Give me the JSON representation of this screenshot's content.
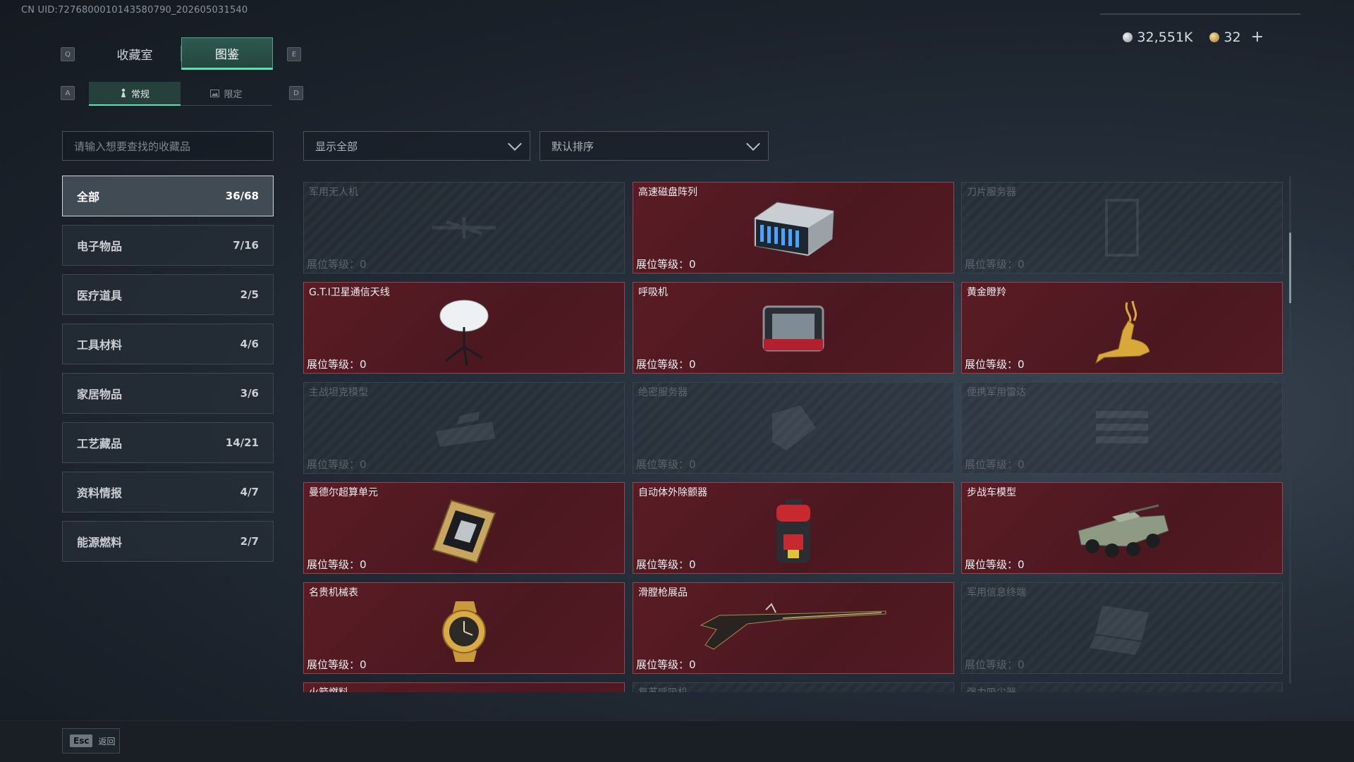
{
  "uid": "CN UID:7276800010143580790_202605031540",
  "keys": {
    "tab_left": "Q",
    "tab_right": "E",
    "sub_left": "A",
    "sub_right": "D"
  },
  "tabs": [
    {
      "label": "收藏室",
      "active": false
    },
    {
      "label": "图鉴",
      "active": true
    }
  ],
  "subtabs": [
    {
      "label": "常规",
      "icon": "figure-icon",
      "active": true
    },
    {
      "label": "限定",
      "icon": "image-icon",
      "active": false
    }
  ],
  "currency": {
    "silver": "32,551K",
    "gold": "32",
    "add": "+"
  },
  "search": {
    "placeholder": "请输入想要查找的收藏品"
  },
  "filters": {
    "show": "显示全部",
    "sort": "默认排序"
  },
  "categories": [
    {
      "label": "全部",
      "count": "36/68"
    },
    {
      "label": "电子物品",
      "count": "7/16"
    },
    {
      "label": "医疗道具",
      "count": "2/5"
    },
    {
      "label": "工具材料",
      "count": "4/6"
    },
    {
      "label": "家居物品",
      "count": "3/6"
    },
    {
      "label": "工艺藏品",
      "count": "14/21"
    },
    {
      "label": "资料情报",
      "count": "4/7"
    },
    {
      "label": "能源燃料",
      "count": "2/7"
    }
  ],
  "items": [
    {
      "name": "军用无人机",
      "level": "展位等级：0",
      "owned": false,
      "icon": "drone-icon"
    },
    {
      "name": "高速磁盘阵列",
      "level": "展位等级：0",
      "owned": true,
      "icon": "disk-array-icon"
    },
    {
      "name": "刀片服务器",
      "level": "展位等级：0",
      "owned": false,
      "icon": "blade-server-icon"
    },
    {
      "name": "G.T.I卫星通信天线",
      "level": "展位等级：0",
      "owned": true,
      "icon": "satellite-dish-icon"
    },
    {
      "name": "呼吸机",
      "level": "展位等级：0",
      "owned": true,
      "icon": "ventilator-icon"
    },
    {
      "name": "黄金瞪羚",
      "level": "展位等级：0",
      "owned": true,
      "icon": "golden-gazelle-icon"
    },
    {
      "name": "主战坦克模型",
      "level": "展位等级：0",
      "owned": false,
      "icon": "tank-model-icon"
    },
    {
      "name": "绝密服务器",
      "level": "展位等级：0",
      "owned": false,
      "icon": "server-icon"
    },
    {
      "name": "便携军用雷达",
      "level": "展位等级：0",
      "owned": false,
      "icon": "radar-icon"
    },
    {
      "name": "曼德尔超算单元",
      "level": "展位等级：0",
      "owned": true,
      "icon": "compute-unit-icon"
    },
    {
      "name": "自动体外除颤器",
      "level": "展位等级：0",
      "owned": true,
      "icon": "defibrillator-icon"
    },
    {
      "name": "步战车模型",
      "level": "展位等级：0",
      "owned": true,
      "icon": "ifv-model-icon"
    },
    {
      "name": "名贵机械表",
      "level": "展位等级：0",
      "owned": true,
      "icon": "watch-icon"
    },
    {
      "name": "滑膛枪展品",
      "level": "展位等级：0",
      "owned": true,
      "icon": "musket-icon"
    },
    {
      "name": "军用信息终端",
      "level": "展位等级：0",
      "owned": false,
      "icon": "terminal-icon"
    },
    {
      "name": "火箭燃料",
      "level": "",
      "owned": true,
      "icon": ""
    },
    {
      "name": "复苏呼吸机",
      "level": "",
      "owned": false,
      "icon": ""
    },
    {
      "name": "强力吸尘器",
      "level": "",
      "owned": false,
      "icon": ""
    }
  ],
  "footer": {
    "key": "Esc",
    "label": "返回"
  }
}
